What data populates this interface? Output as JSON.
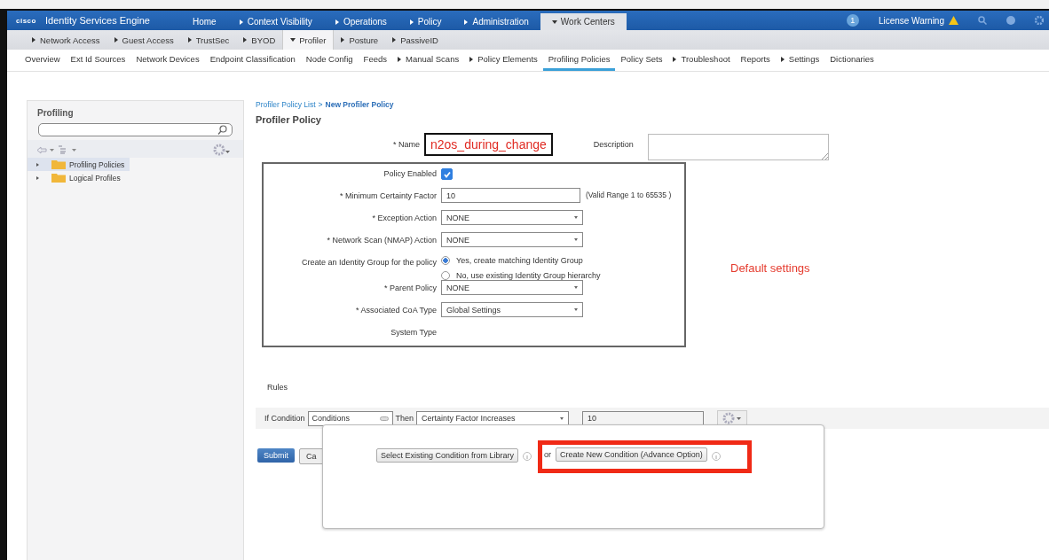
{
  "header": {
    "logo": "cisco",
    "title": "Identity Services Engine",
    "tabs": [
      {
        "label": "Home",
        "submenu": false,
        "expanded": false,
        "selected": false
      },
      {
        "label": "Context Visibility",
        "submenu": true,
        "expanded": false,
        "selected": false
      },
      {
        "label": "Operations",
        "submenu": true,
        "expanded": false,
        "selected": false
      },
      {
        "label": "Policy",
        "submenu": true,
        "expanded": false,
        "selected": false
      },
      {
        "label": "Administration",
        "submenu": true,
        "expanded": false,
        "selected": false
      },
      {
        "label": "Work Centers",
        "submenu": true,
        "expanded": true,
        "selected": true
      }
    ],
    "notification_count": "1",
    "license_warning": "License Warning"
  },
  "subnav": [
    {
      "label": "Network Access",
      "submenu": true,
      "expanded": false,
      "selected": false
    },
    {
      "label": "Guest Access",
      "submenu": true,
      "expanded": false,
      "selected": false
    },
    {
      "label": "TrustSec",
      "submenu": true,
      "expanded": false,
      "selected": false
    },
    {
      "label": "BYOD",
      "submenu": true,
      "expanded": false,
      "selected": false
    },
    {
      "label": "Profiler",
      "submenu": true,
      "expanded": true,
      "selected": true
    },
    {
      "label": "Posture",
      "submenu": true,
      "expanded": false,
      "selected": false
    },
    {
      "label": "PassiveID",
      "submenu": true,
      "expanded": false,
      "selected": false
    }
  ],
  "menu": [
    {
      "label": "Overview",
      "submenu": false,
      "expanded": false,
      "selected": false
    },
    {
      "label": "Ext Id Sources",
      "submenu": false,
      "expanded": false,
      "selected": false
    },
    {
      "label": "Network Devices",
      "submenu": false,
      "expanded": false,
      "selected": false
    },
    {
      "label": "Endpoint Classification",
      "submenu": false,
      "expanded": false,
      "selected": false
    },
    {
      "label": "Node Config",
      "submenu": false,
      "expanded": false,
      "selected": false
    },
    {
      "label": "Feeds",
      "submenu": false,
      "expanded": false,
      "selected": false
    },
    {
      "label": "Manual Scans",
      "submenu": true,
      "expanded": false,
      "selected": false
    },
    {
      "label": "Policy Elements",
      "submenu": true,
      "expanded": false,
      "selected": false
    },
    {
      "label": "Profiling Policies",
      "submenu": false,
      "expanded": false,
      "selected": true
    },
    {
      "label": "Policy Sets",
      "submenu": false,
      "expanded": false,
      "selected": false
    },
    {
      "label": "Troubleshoot",
      "submenu": true,
      "expanded": false,
      "selected": false
    },
    {
      "label": "Reports",
      "submenu": false,
      "expanded": false,
      "selected": false
    },
    {
      "label": "Settings",
      "submenu": true,
      "expanded": false,
      "selected": false
    },
    {
      "label": "Dictionaries",
      "submenu": false,
      "expanded": false,
      "selected": false
    }
  ],
  "sidebar": {
    "title": "Profiling",
    "items": [
      {
        "label": "Profiling Policies",
        "expanded": false,
        "selected": true
      },
      {
        "label": "Logical Profiles",
        "expanded": false,
        "selected": false
      }
    ]
  },
  "breadcrumb": {
    "link": "Profiler Policy List",
    "separator": ">",
    "current": "New Profiler Policy"
  },
  "form_title": "Profiler Policy",
  "name": {
    "label": "* Name",
    "value": "n2os_during_change"
  },
  "description": {
    "label": "Description"
  },
  "settings": [
    {
      "kind": "checkbox",
      "label": "Policy Enabled",
      "checked": true
    },
    {
      "kind": "text",
      "label": "* Minimum Certainty Factor",
      "value": "10",
      "hint": "(Valid Range 1 to 65535 )"
    },
    {
      "kind": "select",
      "label": "* Exception Action",
      "value": "NONE"
    },
    {
      "kind": "select",
      "label": "* Network Scan (NMAP) Action",
      "value": "NONE"
    },
    {
      "kind": "radio",
      "label": "Create an Identity Group for the policy",
      "options": [
        {
          "label": "Yes, create matching Identity Group",
          "selected": true
        },
        {
          "label": "No, use existing Identity Group hierarchy",
          "selected": false
        }
      ]
    },
    {
      "kind": "select",
      "label": "* Parent Policy",
      "value": "NONE"
    },
    {
      "kind": "select",
      "label": "* Associated CoA Type",
      "value": "Global Settings"
    },
    {
      "kind": "static",
      "label": "System Type"
    }
  ],
  "annotation": "Default settings",
  "rules": {
    "title": "Rules",
    "if_label": "If Condition",
    "condition": "Conditions",
    "then_label": "Then",
    "action": "Certainty Factor Increases",
    "amount": "10"
  },
  "buttons": [
    "Submit",
    "Ca"
  ],
  "popup": {
    "library_button": "Select Existing Condition from Library",
    "or": "or",
    "create_button": "Create New Condition (Advance Option)"
  }
}
